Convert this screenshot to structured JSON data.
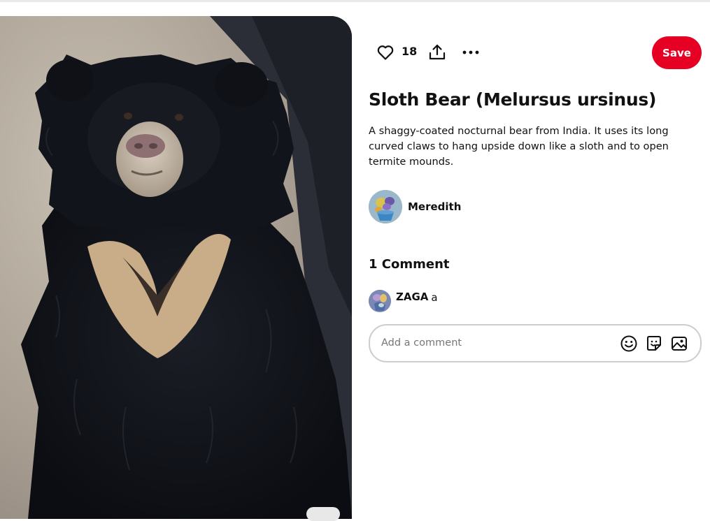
{
  "pin": {
    "image_alt": "Sloth bear photo",
    "title": "Sloth Bear (Melursus ursinus)",
    "description": "A shaggy-coated nocturnal bear from India. It uses its long curved claws to hang upside down like a sloth and to open termite mounds."
  },
  "actions": {
    "like_icon": "heart-icon",
    "like_count": "18",
    "share_icon": "share-upload-icon",
    "more_icon": "more-dots-icon",
    "save_label": "Save",
    "save_color": "#e60023"
  },
  "creator": {
    "name": "Meredith",
    "avatar_icon": "user-avatar"
  },
  "comments": {
    "heading": "1 Comment",
    "items": [
      {
        "author": "ZAGA",
        "text": "a"
      }
    ],
    "input_placeholder": "Add a comment",
    "emoji_icon": "emoji-icon",
    "sticker_icon": "sticker-icon",
    "photo_icon": "image-upload-icon"
  }
}
